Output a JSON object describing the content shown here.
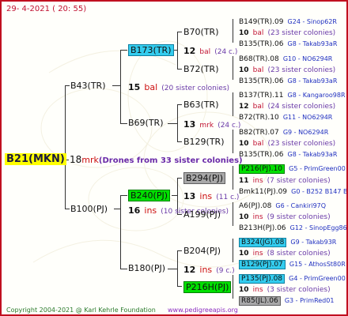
{
  "header": {
    "date": "29-  4-2021  ( 20: 55)"
  },
  "root": {
    "id": "B21(MKN)",
    "count": "18",
    "mate": "mrk",
    "note": "(Drones from 33 sister colonies)"
  },
  "gen1": [
    {
      "id": "B43(TR)",
      "count": "15",
      "mate": "bal",
      "note": "(20 sister colonies)"
    },
    {
      "id": "B100(PJ)",
      "count": "16",
      "mate": "ins",
      "note": "(10 sister colonies)"
    }
  ],
  "gen2": [
    {
      "id": "B173(TR)",
      "count": "12",
      "mate": "bal",
      "note": "(24 c.)"
    },
    {
      "id": "B69(TR)",
      "count": "13",
      "mate": "mrk",
      "note": "(24 c.)"
    },
    {
      "id": "B240(PJ)",
      "count": "13",
      "mate": "ins",
      "note": "(11 c.)"
    },
    {
      "id": "B180(PJ)",
      "count": "12",
      "mate": "ins",
      "note": "(9 c.)"
    }
  ],
  "gen3": [
    {
      "id": "B70(TR)"
    },
    {
      "id": "B72(TR)"
    },
    {
      "id": "B63(TR)"
    },
    {
      "id": "B129(TR)"
    },
    {
      "id": "B294(PJ)"
    },
    {
      "id": "A199(PJ)"
    },
    {
      "id": "B204(PJ)"
    },
    {
      "id": "P216H(PJ)"
    }
  ],
  "gen4": [
    {
      "id": "B149(TR).09",
      "src": "G24 - Sinop62R"
    },
    {
      "count": "10",
      "mate": "bal",
      "note": "(23 sister colonies)"
    },
    {
      "id": "B135(TR).06",
      "src": "G8 - Takab93aR"
    },
    {
      "id": "B68(TR).08",
      "src": "G10 - NO6294R"
    },
    {
      "count": "10",
      "mate": "bal",
      "note": "(23 sister colonies)"
    },
    {
      "id": "B135(TR).06",
      "src": "G8 - Takab93aR"
    },
    {
      "id": "B137(TR).11",
      "src": "G8 - Kangaroo98R"
    },
    {
      "count": "12",
      "mate": "bal",
      "note": "(24 sister colonies)"
    },
    {
      "id": "B72(TR).10",
      "src": "G11 - NO6294R"
    },
    {
      "id": "B82(TR).07",
      "src": "G9 - NO6294R"
    },
    {
      "count": "10",
      "mate": "bal",
      "note": "(23 sister colonies)"
    },
    {
      "id": "B135(TR).06",
      "src": "G8 - Takab93aR"
    },
    {
      "id": "P216(PJ).10",
      "src": "G5 - PrimGreen00"
    },
    {
      "count": "11",
      "mate": "ins",
      "note": "(7 sister colonies)"
    },
    {
      "id": "Bmk11(PJ).09",
      "src": "G0 - B252 B147 B"
    },
    {
      "id": "A6(PJ).08",
      "src": "G6 - Cankiri97Q"
    },
    {
      "count": "10",
      "mate": "ins",
      "note": "(9 sister colonies)"
    },
    {
      "id": "B213H(PJ).06",
      "src": "G12 - SinopEgg86R"
    },
    {
      "id": "B324(JG).08",
      "src": "G9 - Takab93R"
    },
    {
      "count": "10",
      "mate": "ins",
      "note": "(8 sister colonies)"
    },
    {
      "id": "B129(PJ).07",
      "src": "G15 - AthosSt80R"
    },
    {
      "id": "P135(PJ).08",
      "src": "G4 - PrimGreen00"
    },
    {
      "count": "10",
      "mate": "ins",
      "note": "(3 sister colonies)"
    },
    {
      "id": "R85(JL).06",
      "src": "G3 - PrimRed01"
    }
  ],
  "footer": {
    "copyright": "Copyright 2004-2021 @ Karl Kehrle Foundation",
    "url": "www.pedigreeapis.org"
  }
}
